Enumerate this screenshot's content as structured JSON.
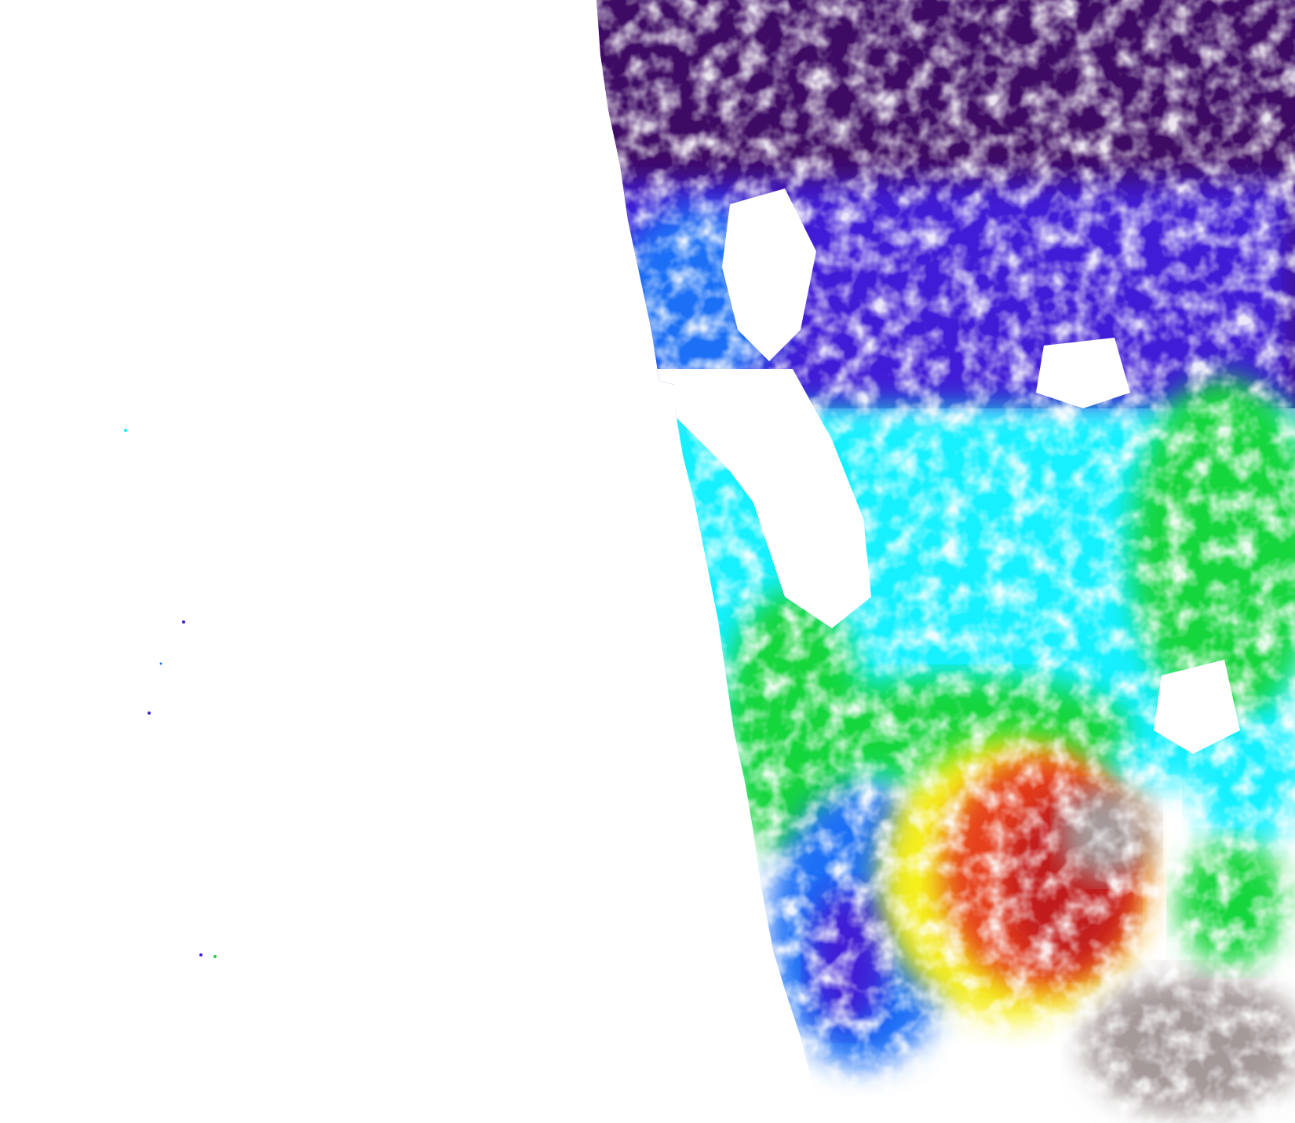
{
  "map": {
    "background_color": "#ffffff",
    "palette": {
      "very_low": "#3d0b63",
      "low": "#3f1ed6",
      "medium_low": "#1e6ff6",
      "medium": "#12f0ff",
      "medium_high": "#12d63c",
      "high": "#f5ef1c",
      "very_high": "#e6401c",
      "peak": "#c11a1a",
      "saturated": "#a59a9a",
      "cloud_mask": "#ffffff"
    },
    "legend": [],
    "title": ""
  }
}
